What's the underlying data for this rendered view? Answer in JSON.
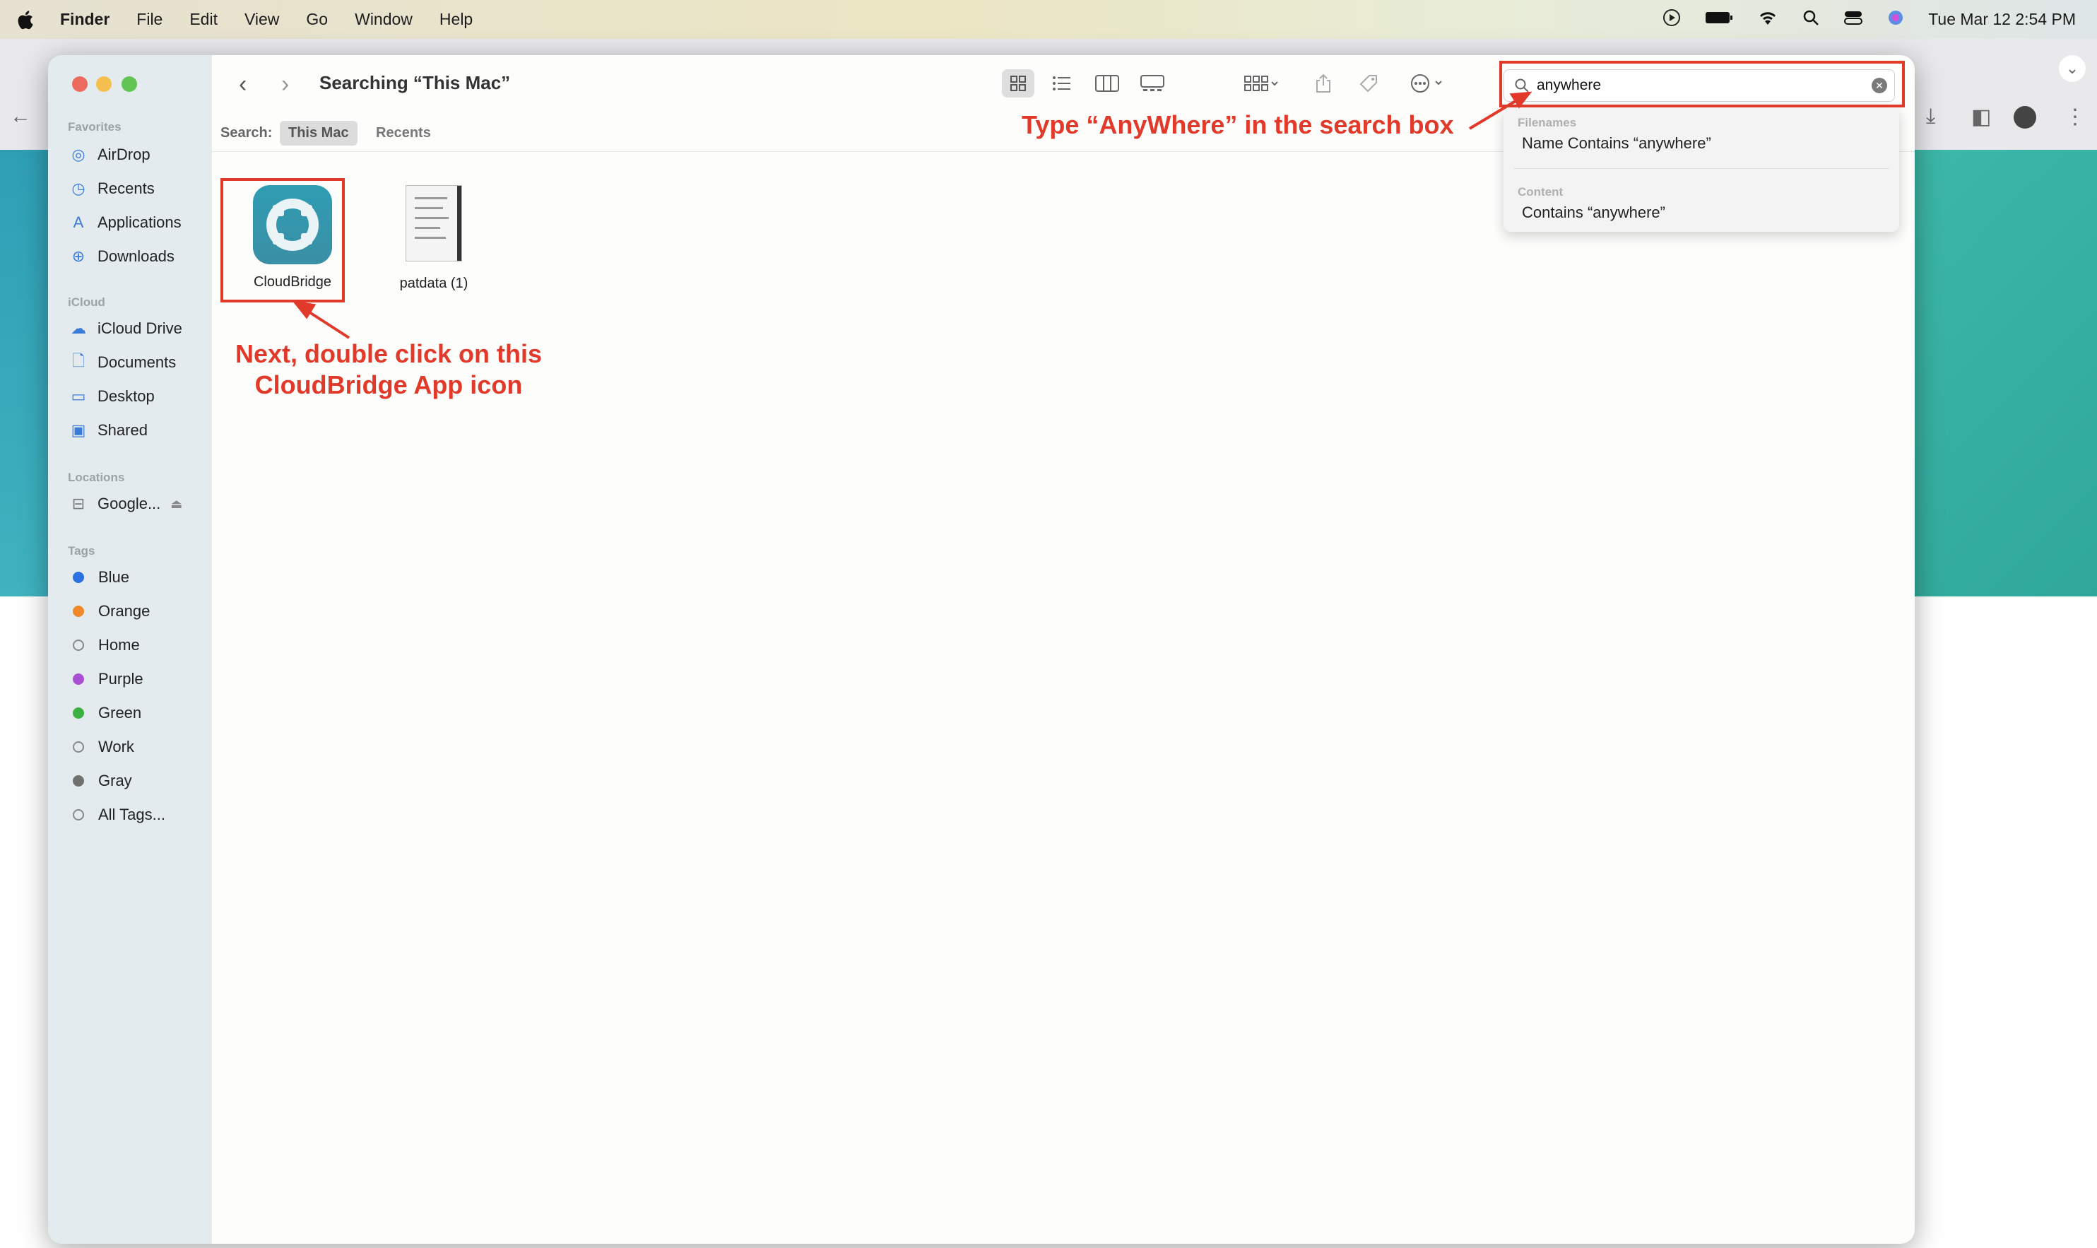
{
  "menubar": {
    "app": "Finder",
    "items": [
      "File",
      "Edit",
      "View",
      "Go",
      "Window",
      "Help"
    ],
    "clock": "Tue Mar 12  2:54 PM"
  },
  "window": {
    "title": "Searching “This Mac”",
    "search": {
      "scope_label": "Search:",
      "scopes": [
        "This Mac",
        "Recents"
      ],
      "query": "anywhere"
    }
  },
  "sidebar": {
    "favorites_label": "Favorites",
    "favorites": [
      "AirDrop",
      "Recents",
      "Applications",
      "Downloads"
    ],
    "icloud_label": "iCloud",
    "icloud": [
      "iCloud Drive",
      "Documents",
      "Desktop",
      "Shared"
    ],
    "locations_label": "Locations",
    "locations": [
      "Google..."
    ],
    "tags_label": "Tags",
    "tags": [
      {
        "name": "Blue",
        "color": "#2b6fe0"
      },
      {
        "name": "Orange",
        "color": "#f0882a"
      },
      {
        "name": "Home",
        "color": ""
      },
      {
        "name": "Purple",
        "color": "#a94fd3"
      },
      {
        "name": "Green",
        "color": "#3cb043"
      },
      {
        "name": "Work",
        "color": ""
      },
      {
        "name": "Gray",
        "color": "#707070"
      },
      {
        "name": "All Tags...",
        "color": ""
      }
    ]
  },
  "files": [
    {
      "name": "CloudBridge",
      "icon": "app-icon"
    },
    {
      "name": "patdata (1)",
      "icon": "document-icon"
    }
  ],
  "search_dropdown": {
    "filenames_header": "Filenames",
    "filenames_item": "Name Contains “anywhere”",
    "content_header": "Content",
    "content_item": "Contains “anywhere”"
  },
  "annotations": {
    "search_hint": "Type “AnyWhere” in the search box",
    "icon_hint_line1": "Next, double click on this",
    "icon_hint_line2": "CloudBridge App icon",
    "color": "#e23a2a"
  }
}
